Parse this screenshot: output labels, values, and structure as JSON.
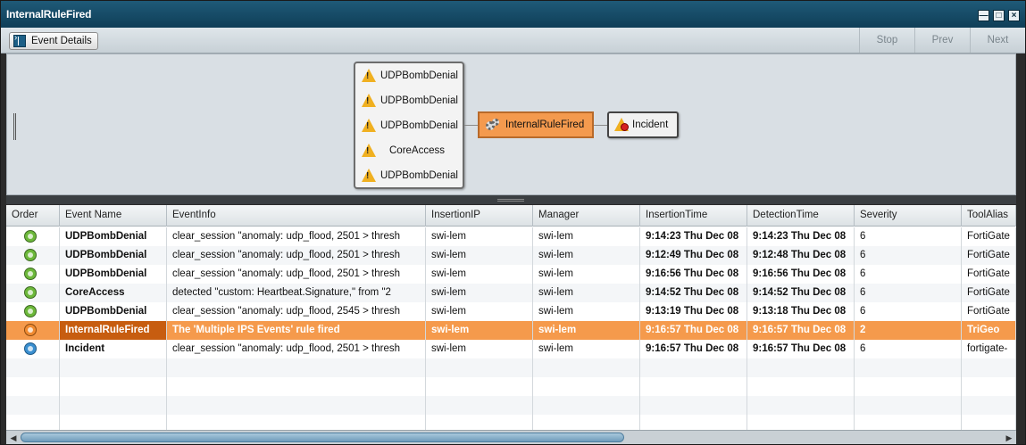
{
  "window": {
    "title": "InternalRuleFired",
    "controls": [
      "—",
      "□",
      "×"
    ]
  },
  "toolbar": {
    "event_details_label": "Event Details",
    "stop_label": "Stop",
    "prev_label": "Prev",
    "next_label": "Next"
  },
  "graph": {
    "source_nodes": [
      {
        "label": "UDPBombDenial"
      },
      {
        "label": "UDPBombDenial"
      },
      {
        "label": "UDPBombDenial"
      },
      {
        "label": "CoreAccess"
      },
      {
        "label": "UDPBombDenial"
      }
    ],
    "rule_node": {
      "label": "InternalRuleFired"
    },
    "incident_node": {
      "label": "Incident"
    }
  },
  "table": {
    "columns": [
      "Order",
      "Event Name",
      "EventInfo",
      "InsertionIP",
      "Manager",
      "InsertionTime",
      "DetectionTime",
      "Severity",
      "ToolAlias"
    ],
    "rows": [
      {
        "order_icon": "green-arrow-icon",
        "event_name": "UDPBombDenial",
        "event_info": "clear_session \"anomaly: udp_flood, 2501 > thresh",
        "insertion_ip": "swi-lem",
        "manager": "swi-lem",
        "insertion_time": "9:14:23 Thu Dec 08",
        "detection_time": "9:14:23 Thu Dec 08",
        "severity": "6",
        "tool_alias": "FortiGate"
      },
      {
        "order_icon": "green-arrow-icon",
        "event_name": "UDPBombDenial",
        "event_info": "clear_session \"anomaly: udp_flood, 2501 > thresh",
        "insertion_ip": "swi-lem",
        "manager": "swi-lem",
        "insertion_time": "9:12:49 Thu Dec 08",
        "detection_time": "9:12:48 Thu Dec 08",
        "severity": "6",
        "tool_alias": "FortiGate"
      },
      {
        "order_icon": "green-arrow-icon",
        "event_name": "UDPBombDenial",
        "event_info": "clear_session \"anomaly: udp_flood, 2501 > thresh",
        "insertion_ip": "swi-lem",
        "manager": "swi-lem",
        "insertion_time": "9:16:56 Thu Dec 08",
        "detection_time": "9:16:56 Thu Dec 08",
        "severity": "6",
        "tool_alias": "FortiGate"
      },
      {
        "order_icon": "green-arrow-icon",
        "event_name": "CoreAccess",
        "event_info": "detected \"custom: Heartbeat.Signature,\" from \"2",
        "insertion_ip": "swi-lem",
        "manager": "swi-lem",
        "insertion_time": "9:14:52 Thu Dec 08",
        "detection_time": "9:14:52 Thu Dec 08",
        "severity": "6",
        "tool_alias": "FortiGate"
      },
      {
        "order_icon": "green-arrow-icon",
        "event_name": "UDPBombDenial",
        "event_info": "clear_session \"anomaly: udp_flood, 2545 > thresh",
        "insertion_ip": "swi-lem",
        "manager": "swi-lem",
        "insertion_time": "9:13:19 Thu Dec 08",
        "detection_time": "9:13:18 Thu Dec 08",
        "severity": "6",
        "tool_alias": "FortiGate"
      },
      {
        "order_icon": "orange-dot-icon",
        "event_name": "InternalRuleFired",
        "event_info": "The 'Multiple IPS Events' rule fired",
        "insertion_ip": "swi-lem",
        "manager": "swi-lem",
        "insertion_time": "9:16:57 Thu Dec 08",
        "detection_time": "9:16:57 Thu Dec 08",
        "severity": "2",
        "tool_alias": "TriGeo",
        "selected": true
      },
      {
        "order_icon": "blue-arrow-icon",
        "event_name": "Incident",
        "event_info": "clear_session \"anomaly: udp_flood, 2501 > thresh",
        "insertion_ip": "swi-lem",
        "manager": "swi-lem",
        "insertion_time": "9:16:57 Thu Dec 08",
        "detection_time": "9:16:57 Thu Dec 08",
        "severity": "6",
        "tool_alias": "fortigate-"
      }
    ]
  },
  "colors": {
    "title_bar": "#0f3e57",
    "selected_row": "#f59a4c",
    "selected_name_cell": "#c75d10",
    "rule_node": "#f49a4e",
    "warning": "#f0b020",
    "green_icon": "#6cb83a",
    "blue_icon": "#3a8fd0"
  }
}
